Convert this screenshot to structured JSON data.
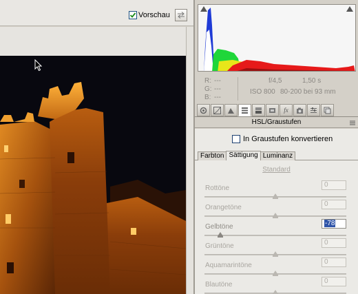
{
  "toolbar": {
    "preview_label": "Vorschau",
    "preview_checked": true
  },
  "info": {
    "r_label": "R:",
    "r_value": "---",
    "g_label": "G:",
    "g_value": "---",
    "b_label": "B:",
    "b_value": "---",
    "aperture": "f/4,5",
    "shutter": "1,50 s",
    "iso": "ISO 800",
    "lens": "80-200 bei 93 mm"
  },
  "panel": {
    "title": "HSL/Graustufen",
    "grayscale_label": "In Graustufen konvertieren",
    "tabs": [
      "Farbton",
      "Sättigung",
      "Luminanz"
    ],
    "active_tab": "Sättigung",
    "standard_link": "Standard"
  },
  "sliders": [
    {
      "label": "Rottöne",
      "value": "0",
      "level": 0
    },
    {
      "label": "Orangetöne",
      "value": "0",
      "level": 0
    },
    {
      "label": "Gelbtöne",
      "value": "-78",
      "level": -78,
      "active": true
    },
    {
      "label": "Grüntöne",
      "value": "0",
      "level": 0
    },
    {
      "label": "Aquamarintöne",
      "value": "0",
      "level": 0
    },
    {
      "label": "Blautöne",
      "value": "0",
      "level": 0
    }
  ],
  "colors": {
    "accent_blue": "#2f54a8",
    "histogram_blue": "#1f3bd6",
    "histogram_green": "#1fd63a",
    "histogram_yellow": "#e8e61a",
    "histogram_red": "#e61a1a"
  },
  "icons": [
    "checkmark-icon",
    "swap-icon",
    "arrow-cursor-icon",
    "clip-warning-icon",
    "panel-menu-icon"
  ]
}
